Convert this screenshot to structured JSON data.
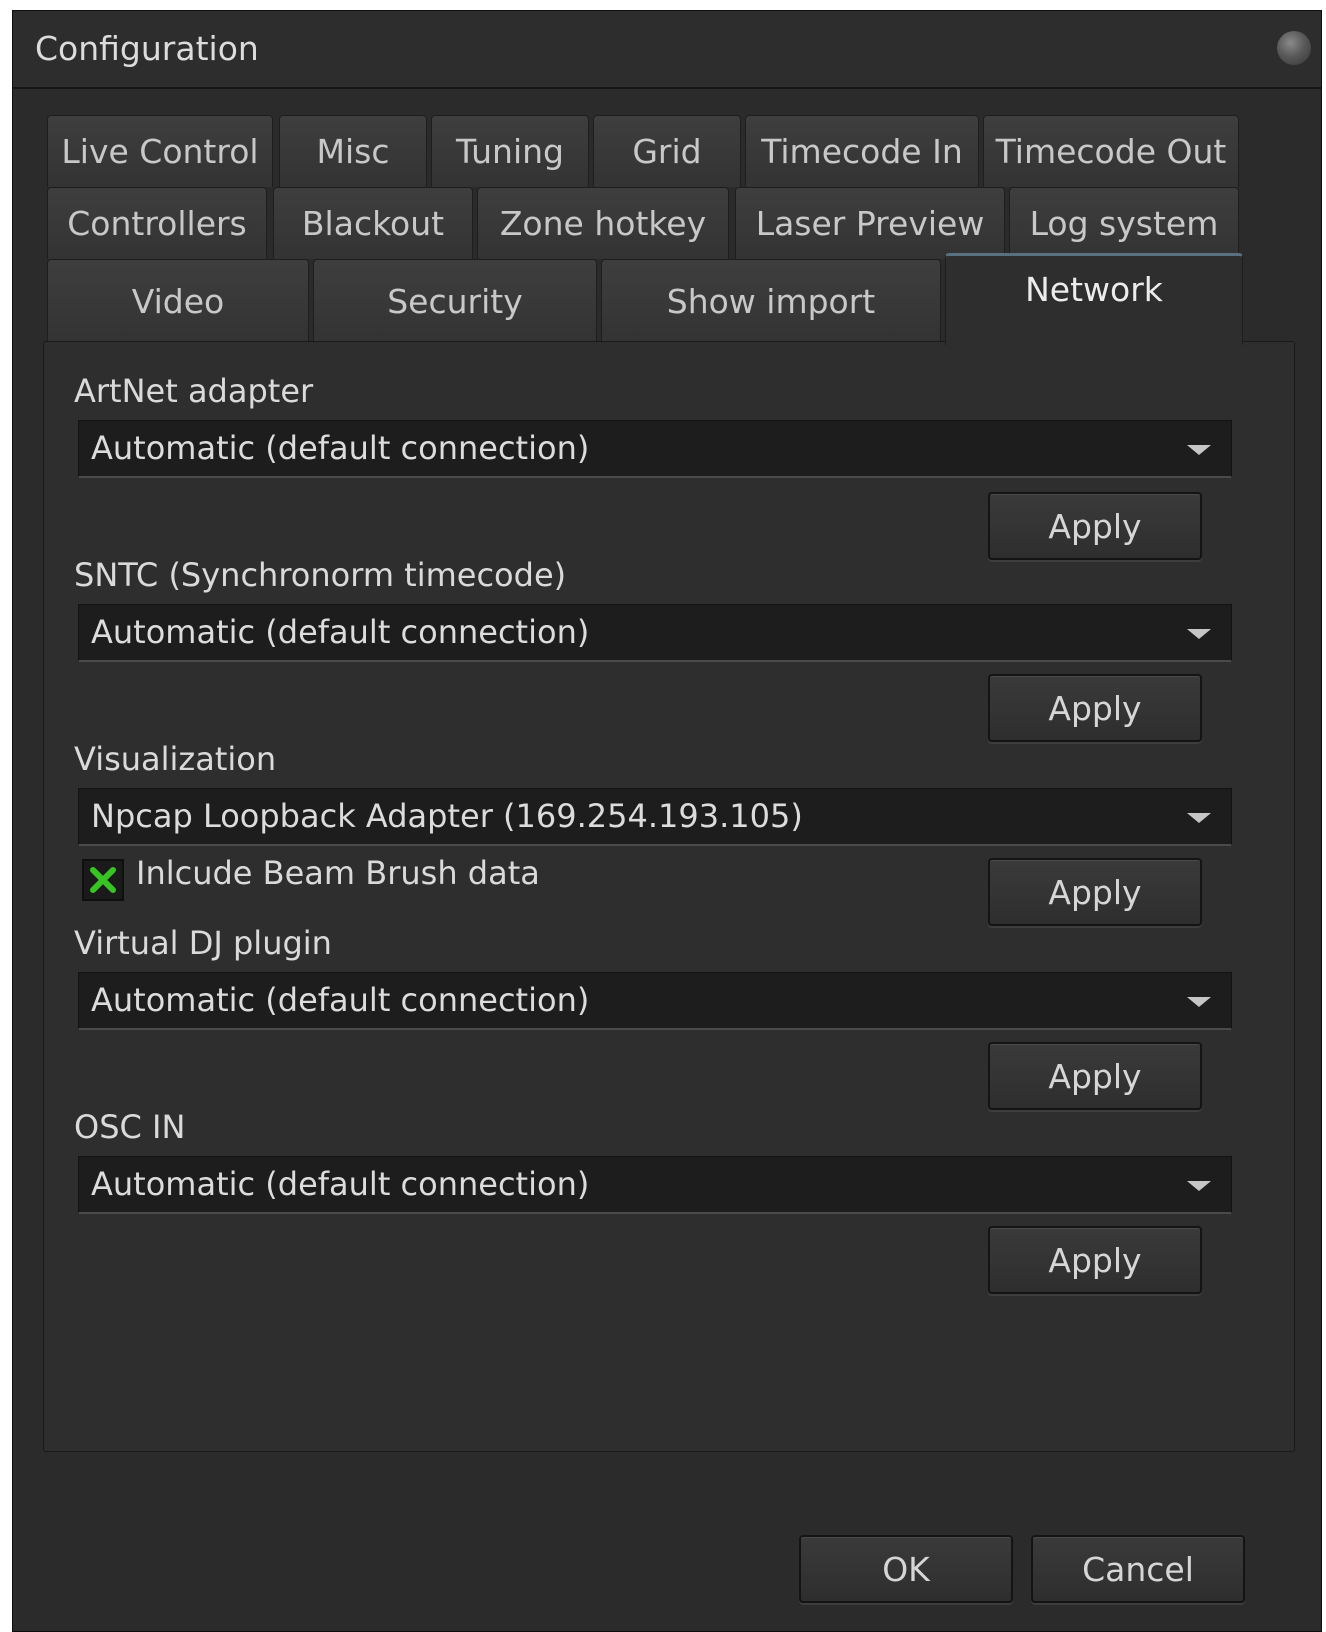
{
  "window": {
    "title": "Configuration"
  },
  "tabs": {
    "row1": [
      "Live Control",
      "Misc",
      "Tuning",
      "Grid",
      "Timecode In",
      "Timecode Out"
    ],
    "row2": [
      "Controllers",
      "Blackout",
      "Zone hotkey",
      "Laser Preview",
      "Log system"
    ],
    "row3": [
      "Video",
      "Security",
      "Show import",
      "Network"
    ],
    "active": "Network"
  },
  "network": {
    "artnet": {
      "label": "ArtNet adapter",
      "value": "Automatic (default connection)",
      "apply": "Apply"
    },
    "sntc": {
      "label": "SNTC (Synchronorm timecode)",
      "value": "Automatic (default connection)",
      "apply": "Apply"
    },
    "visualization": {
      "label": "Visualization",
      "value": "Npcap Loopback Adapter (169.254.193.105)",
      "checkbox_label": "Inlcude Beam Brush data",
      "checkbox_checked": true,
      "apply": "Apply"
    },
    "virtualdj": {
      "label": "Virtual DJ plugin",
      "value": "Automatic (default connection)",
      "apply": "Apply"
    },
    "osc": {
      "label": "OSC IN",
      "value": "Automatic (default connection)",
      "apply": "Apply"
    }
  },
  "footer": {
    "ok": "OK",
    "cancel": "Cancel"
  },
  "colors": {
    "background": "#2b2b2b",
    "active_tab_accent": "#59707f",
    "checkbox_mark": "#39c425"
  }
}
